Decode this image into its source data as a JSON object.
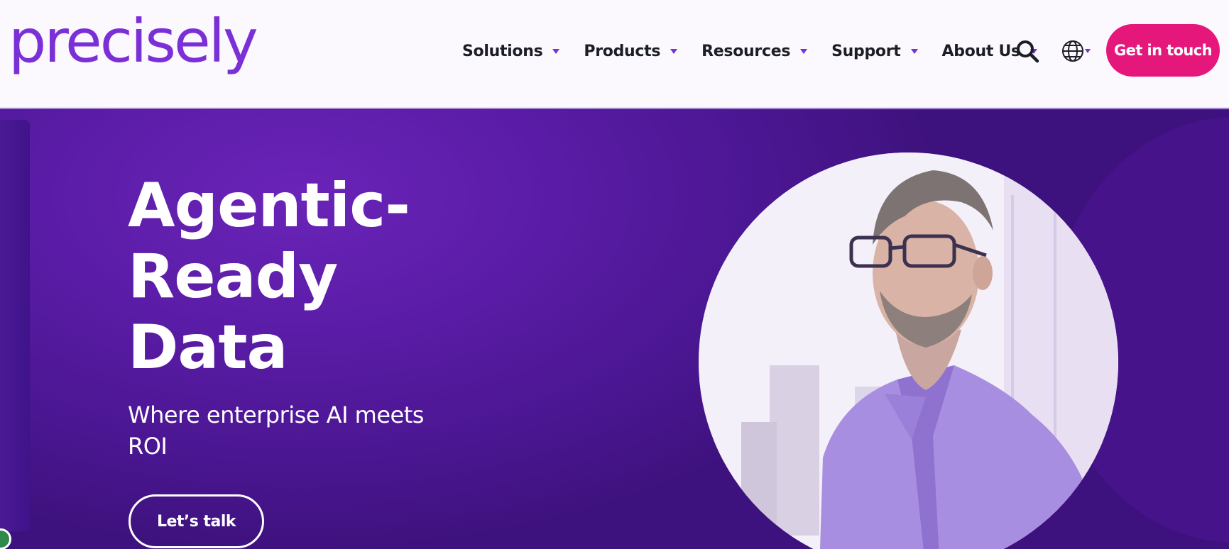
{
  "header": {
    "logo_text": "precisely",
    "nav": [
      {
        "label": "Solutions"
      },
      {
        "label": "Products"
      },
      {
        "label": "Resources"
      },
      {
        "label": "Support"
      },
      {
        "label": "About Us"
      }
    ],
    "search_icon": "search-icon",
    "language_icon": "globe-icon",
    "cta_label": "Get in touch"
  },
  "hero": {
    "headline_lines": [
      "Agentic-",
      "Ready",
      "Data"
    ],
    "subhead": "Where enterprise AI meets ROI",
    "button_label": "Let’s talk",
    "image": "man-with-glasses-photo"
  },
  "colors": {
    "brand_purple": "#7b2fd6",
    "hero_purple": "#5a1ca6",
    "cta_pink": "#e5177b",
    "header_bg": "#fbf9fd"
  }
}
